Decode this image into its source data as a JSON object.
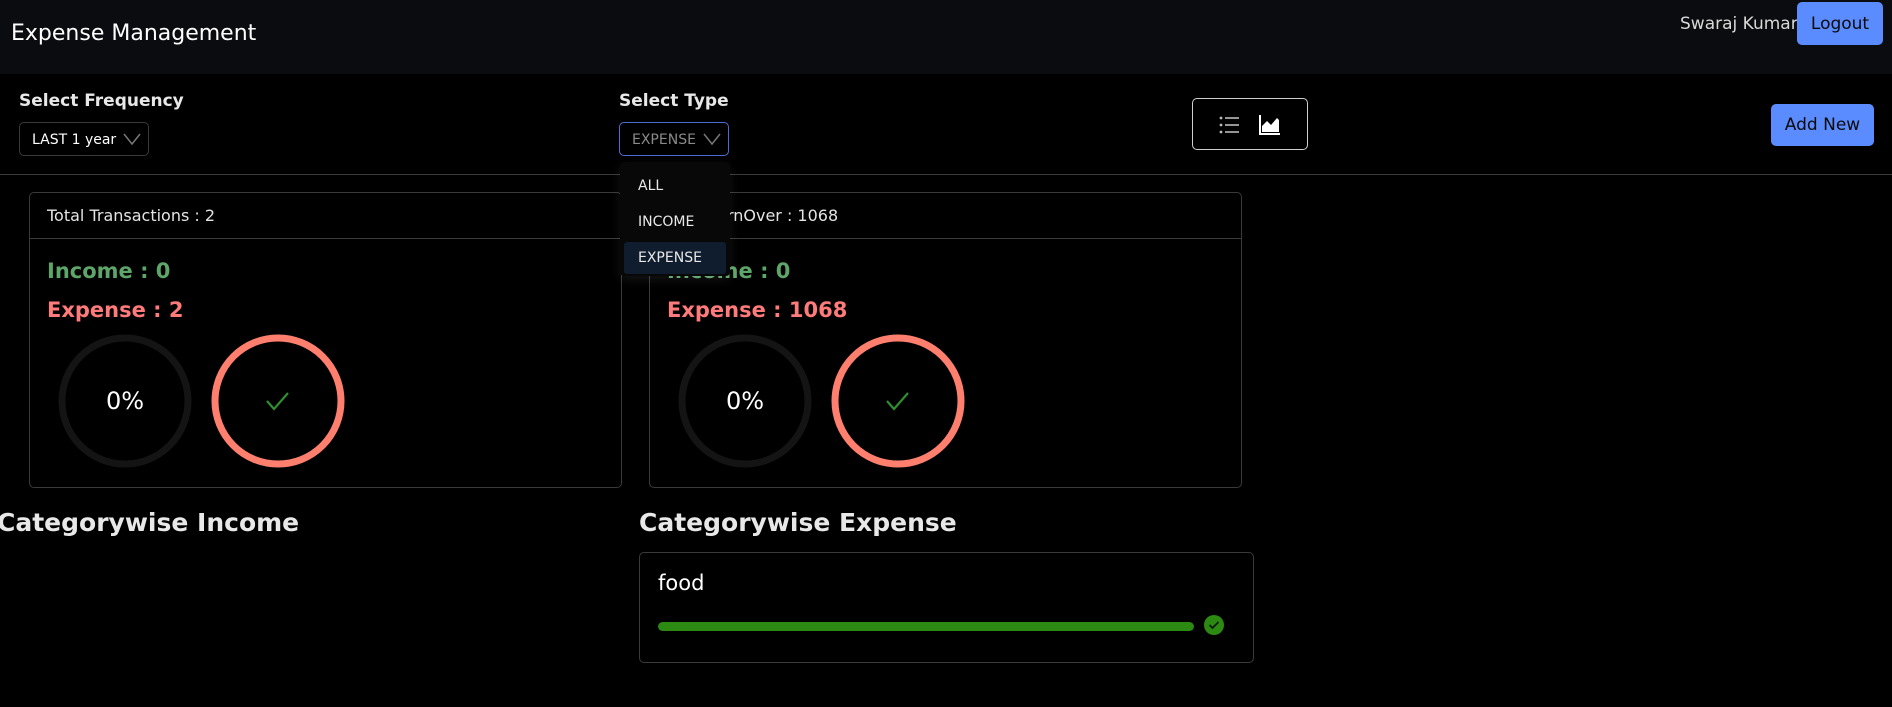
{
  "header": {
    "title": "Expense Management",
    "user_name": "Swaraj Kumar",
    "logout_label": "Logout"
  },
  "filters": {
    "frequency_label": "Select Frequency",
    "frequency_value": "LAST 1 year",
    "type_label": "Select Type",
    "type_value": "EXPENSE",
    "type_options": [
      "ALL",
      "INCOME",
      "EXPENSE"
    ]
  },
  "toolbar": {
    "view_icons": [
      "list-icon",
      "chart-icon"
    ],
    "add_new_label": "Add New"
  },
  "cards": [
    {
      "header": "Total Transactions : 2",
      "income": "Income : 0",
      "expense": "Expense : 2",
      "income_percent_label": "0%",
      "income_percent": 0,
      "expense_percent": 100
    },
    {
      "header": "Total TurnOver : 1068",
      "income": "Income : 0",
      "expense": "Expense : 1068",
      "income_percent_label": "0%",
      "income_percent": 0,
      "expense_percent": 100
    }
  ],
  "sections": {
    "income_title": "Categorywise Income",
    "expense_title": "Categorywise Expense"
  },
  "expense_categories": [
    {
      "name": "food",
      "percent": 100
    }
  ],
  "colors": {
    "accent": "#5b8cff",
    "income": "#5ea56a",
    "expense": "#ff7a7a",
    "ring_expense": "#ff7f6e",
    "progress_green": "#2c8a12"
  }
}
